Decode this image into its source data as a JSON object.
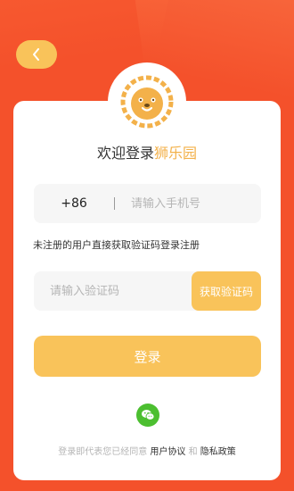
{
  "header": {
    "back_icon": "chevron-left-icon"
  },
  "logo": {
    "icon": "lion-icon",
    "color": "#f3b14a"
  },
  "welcome": {
    "prefix": "欢迎登录",
    "brand": "狮乐园"
  },
  "phone": {
    "country_code": "+86",
    "separator": "|",
    "placeholder": "请输入手机号"
  },
  "hint": "未注册的用户直接获取验证码登录注册",
  "code": {
    "placeholder": "请输入验证码",
    "button_label": "获取验证码"
  },
  "login": {
    "label": "登录"
  },
  "wechat": {
    "icon": "wechat-icon"
  },
  "agreement": {
    "prefix": "登录即代表您已经同意",
    "user_agreement": "用户协议",
    "and": "和",
    "privacy_policy": "隐私政策"
  },
  "colors": {
    "background": "#f4512b",
    "accent": "#f9c35a",
    "brand_text": "#f3b14a",
    "wechat": "#4cbf30"
  }
}
